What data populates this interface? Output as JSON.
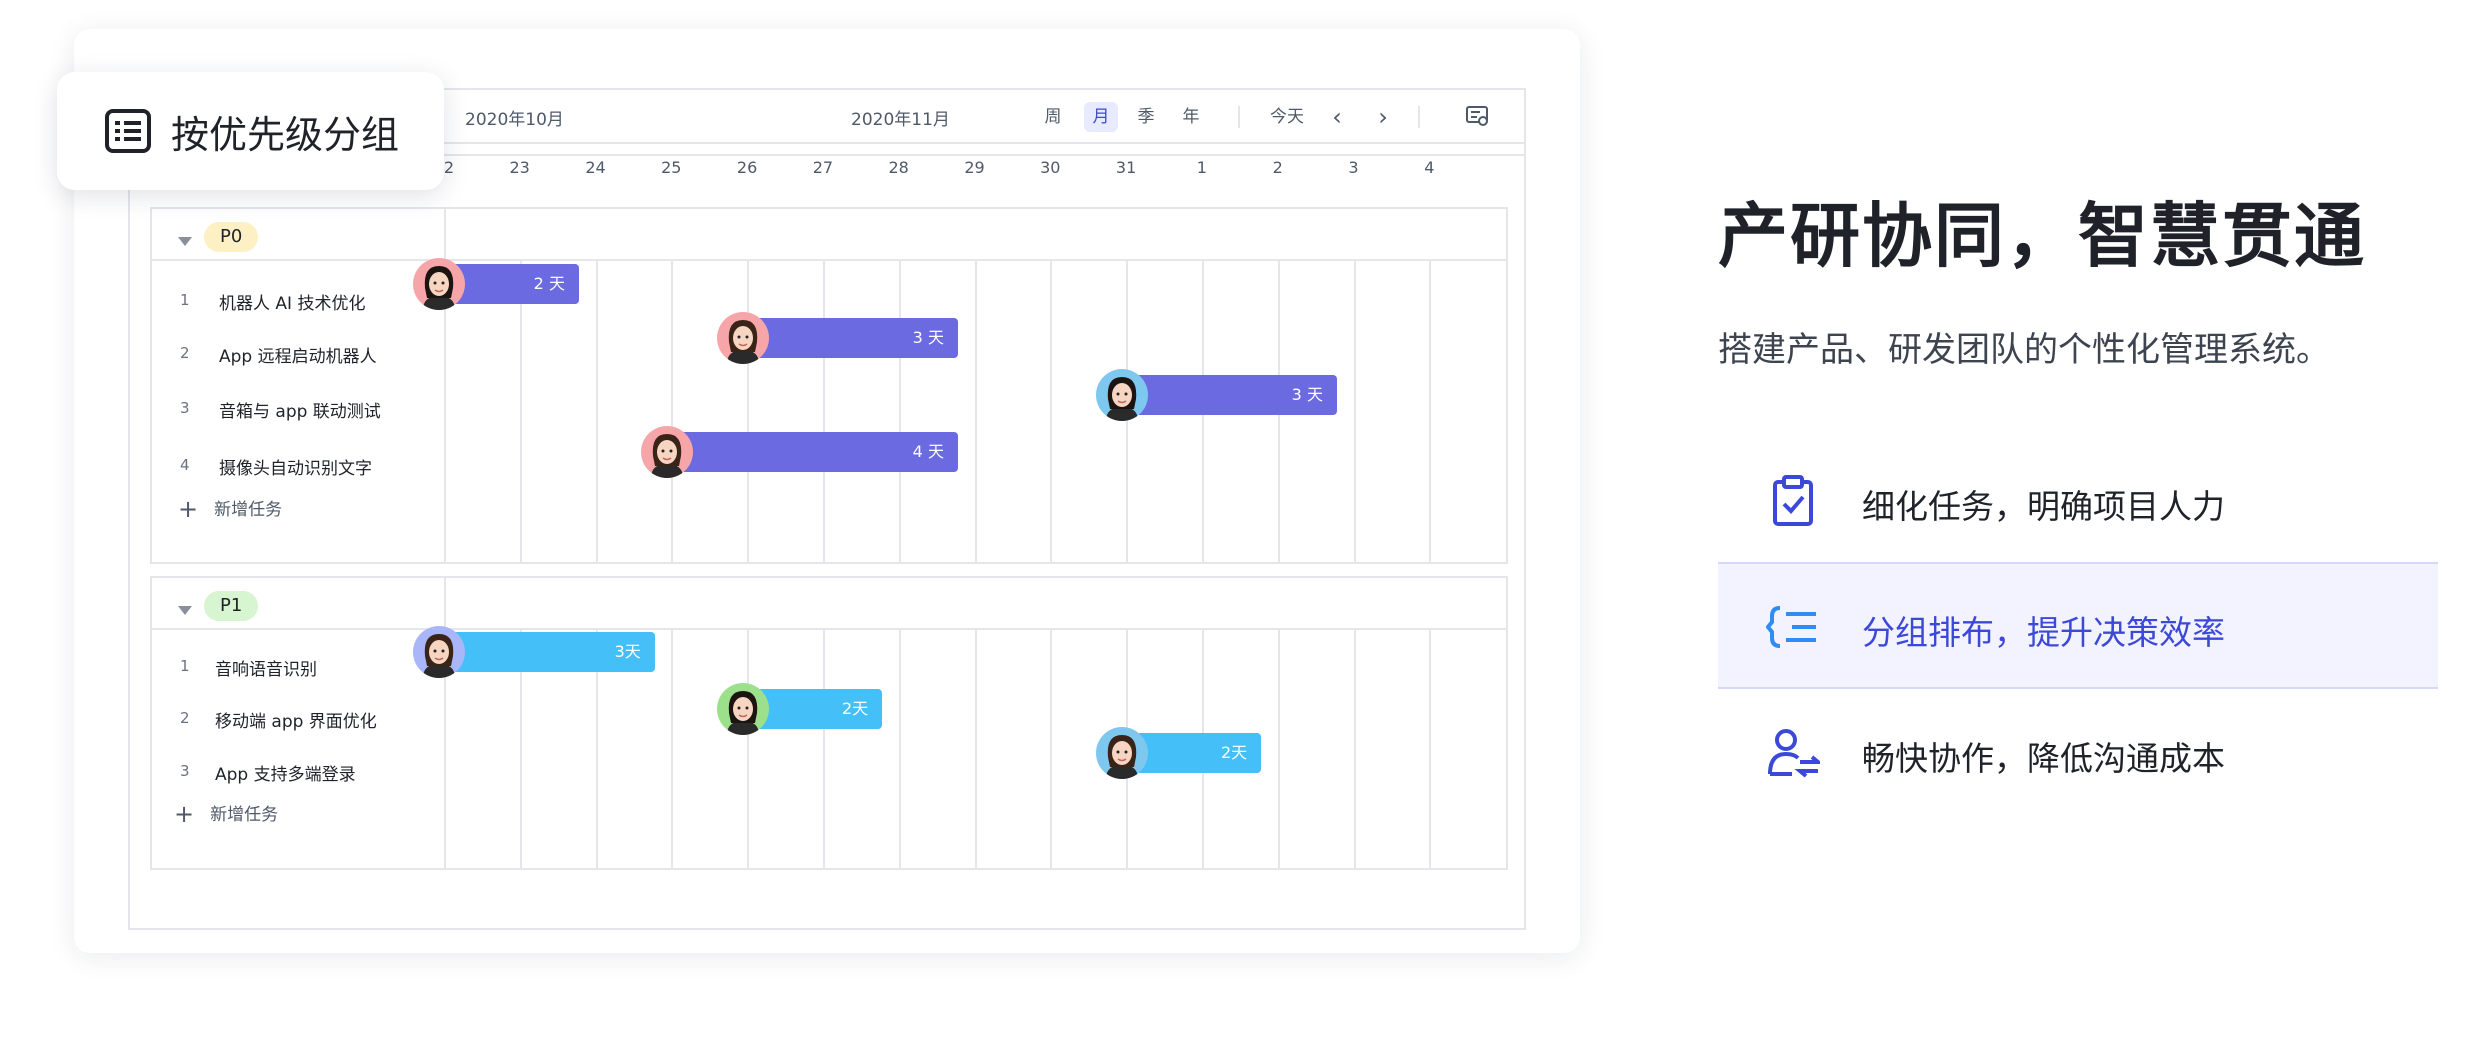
{
  "group_chip": {
    "label": "按优先级分组",
    "icon": "list-icon"
  },
  "toolbar": {
    "month_left": "2020年10月",
    "month_right": "2020年11月",
    "views": [
      "周",
      "月",
      "季",
      "年"
    ],
    "active_view": "月",
    "today": "今天",
    "prev": "‹",
    "next": "›",
    "settings_icon": "gantt-settings-icon"
  },
  "dates": [
    "22",
    "23",
    "24",
    "25",
    "26",
    "27",
    "28",
    "29",
    "30",
    "31",
    "1",
    "2",
    "3",
    "4"
  ],
  "groups": [
    {
      "tag": "P0",
      "tag_color": "#fdf0c4",
      "bar_color": "#6b6ae0",
      "add_label": "新增任务",
      "tasks": [
        {
          "num": "1",
          "title": "机器人 AI 技术优化",
          "duration": "2 天",
          "avatar_bg": "#f6a6a8"
        },
        {
          "num": "2",
          "title": "App 远程启动机器人",
          "duration": "3 天",
          "avatar_bg": "#f6a6a8"
        },
        {
          "num": "3",
          "title": "音箱与 app 联动测试",
          "duration": "3 天",
          "avatar_bg": "#7ec8f0"
        },
        {
          "num": "4",
          "title": "摄像头自动识别文字",
          "duration": "4 天",
          "avatar_bg": "#f6a6a8"
        }
      ]
    },
    {
      "tag": "P1",
      "tag_color": "#d6f5d0",
      "bar_color": "#45bff7",
      "add_label": "新增任务",
      "tasks": [
        {
          "num": "1",
          "title": "音响语音识别",
          "duration": "3天",
          "avatar_bg": "#a9b6f8"
        },
        {
          "num": "2",
          "title": "移动端 app 界面优化",
          "duration": "2天",
          "avatar_bg": "#9de08c"
        },
        {
          "num": "3",
          "title": "App 支持多端登录",
          "duration": "2天",
          "avatar_bg": "#7ec8f0"
        }
      ]
    }
  ],
  "right": {
    "title": "产研协同，智慧贯通",
    "subtitle": "搭建产品、研发团队的个性化管理系统。",
    "features": [
      {
        "label": "细化任务，明确项目人力",
        "icon": "clipboard-check-icon",
        "highlighted": false
      },
      {
        "label": "分组排布，提升决策效率",
        "icon": "grouped-list-icon",
        "highlighted": true
      },
      {
        "label": "畅快协作，降低沟通成本",
        "icon": "user-swap-icon",
        "highlighted": false
      }
    ]
  },
  "colors": {
    "accent": "#3c49d8",
    "p0_bar": "#6b6ae0",
    "p1_bar": "#45bff7"
  }
}
